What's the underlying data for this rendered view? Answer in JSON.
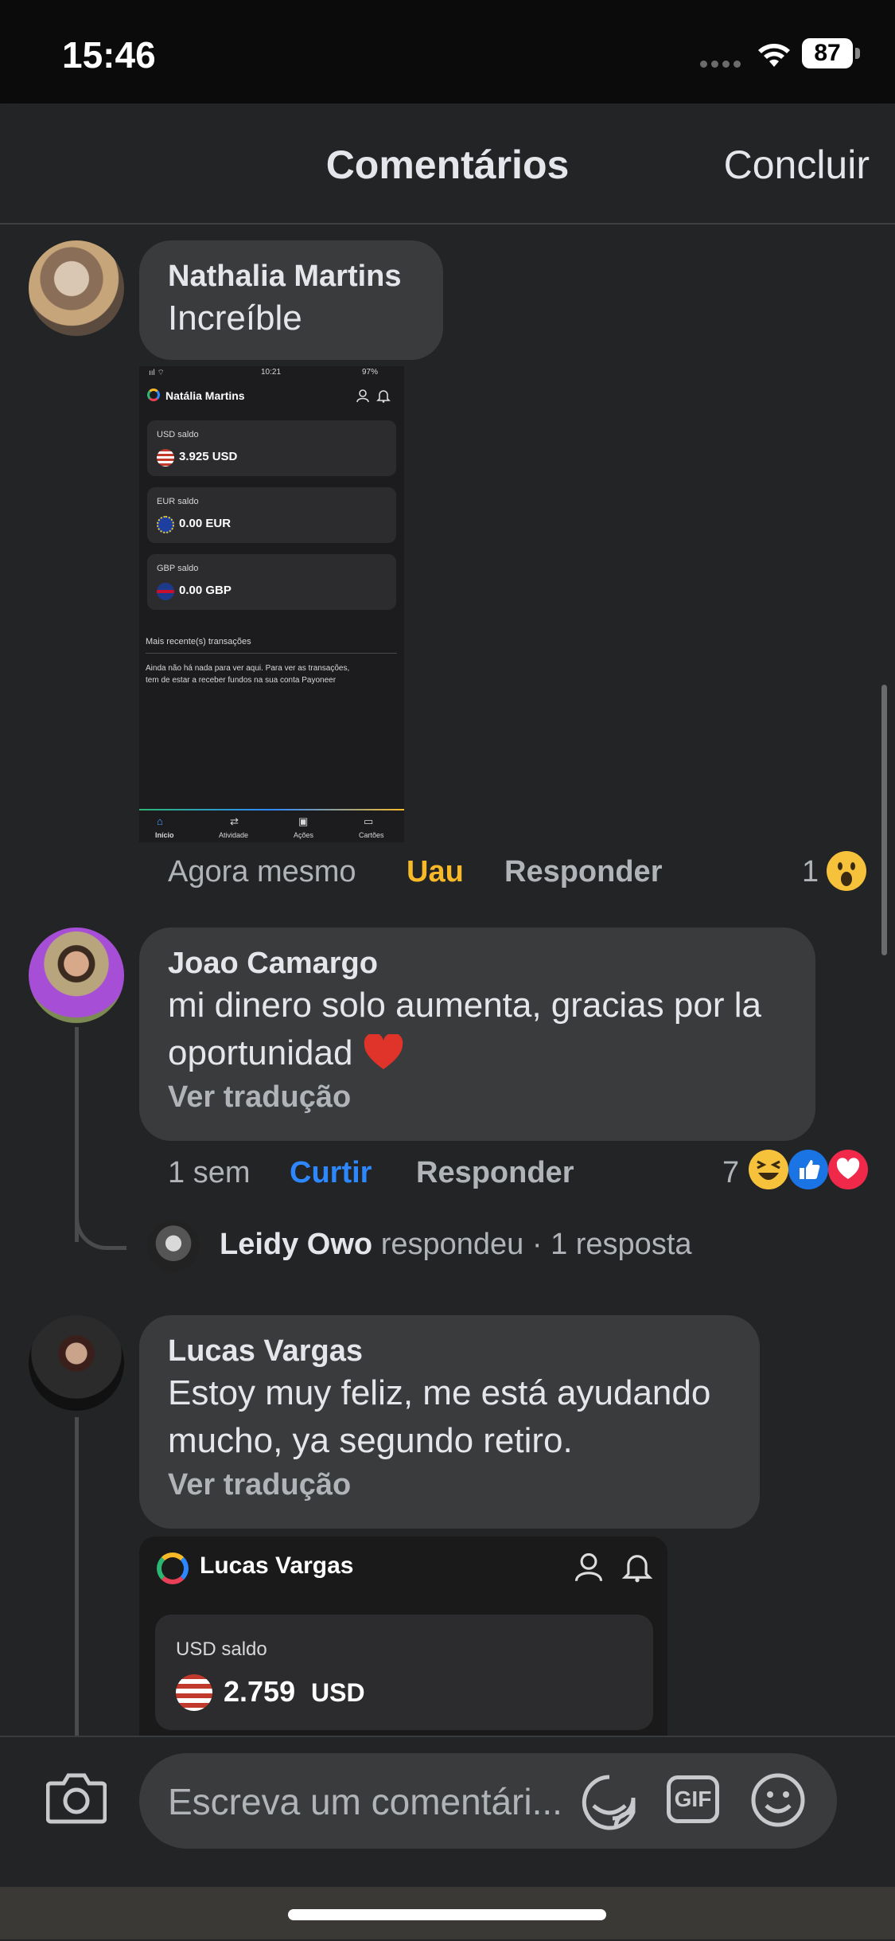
{
  "status_bar": {
    "time": "15:46",
    "battery": "87"
  },
  "header": {
    "title": "Comentários",
    "done_label": "Concluir"
  },
  "comments": [
    {
      "author": "Nathalia Martins",
      "text": "Increíble",
      "time": "Agora mesmo",
      "reaction_label": "Uau",
      "reply_label": "Responder",
      "reaction_count": "1",
      "attachment": {
        "status_time": "10:21",
        "battery_text": "97%",
        "account_name": "Natália Martins",
        "balances": [
          {
            "label": "USD saldo",
            "amount": "3.925 USD"
          },
          {
            "label": "EUR saldo",
            "amount": "0.00 EUR"
          },
          {
            "label": "GBP saldo",
            "amount": "0.00 GBP"
          }
        ],
        "recent_title": "Mais recente(s) transações",
        "empty_text_1": "Ainda não há nada para ver aqui. Para ver as transações,",
        "empty_text_2": "tem de estar a receber fundos na sua conta Payoneer",
        "tabs": [
          "Início",
          "Atividade",
          "Ações",
          "Cartões"
        ]
      }
    },
    {
      "author": "Joao Camargo",
      "text_line1": "mi dinero solo aumenta, gracias por la",
      "text_line2": "oportunidad",
      "translate_label": "Ver tradução",
      "time": "1 sem",
      "like_label": "Curtir",
      "reply_label": "Responder",
      "reaction_count": "7",
      "reply_preview": {
        "author": "Leidy Owo",
        "action": "respondeu",
        "count": "· 1 resposta"
      }
    },
    {
      "author": "Lucas Vargas",
      "text_line1": "Estoy muy feliz, me está ayudando",
      "text_line2": "mucho, ya segundo retiro.",
      "translate_label": "Ver tradução",
      "attachment": {
        "account_name": "Lucas Vargas",
        "balance_label": "USD saldo",
        "balance_amount": "2.759",
        "balance_currency": "USD"
      }
    }
  ],
  "composer": {
    "placeholder": "Escreva um comentári...",
    "gif_label": "GIF"
  },
  "colors": {
    "background": "#232425",
    "bubble": "#3a3b3c",
    "uau": "#f7b928",
    "like_blue": "#2d88ff",
    "text": "#e4e6eb",
    "muted": "#b0b3b8"
  },
  "icons": [
    "wifi-icon",
    "camera-icon",
    "sticker-icon",
    "gif-icon",
    "emoji-icon",
    "wow-emoji-icon",
    "haha-emoji-icon",
    "like-emoji-icon",
    "love-emoji-icon",
    "heart-emoji-icon",
    "user-icon",
    "bell-icon"
  ]
}
